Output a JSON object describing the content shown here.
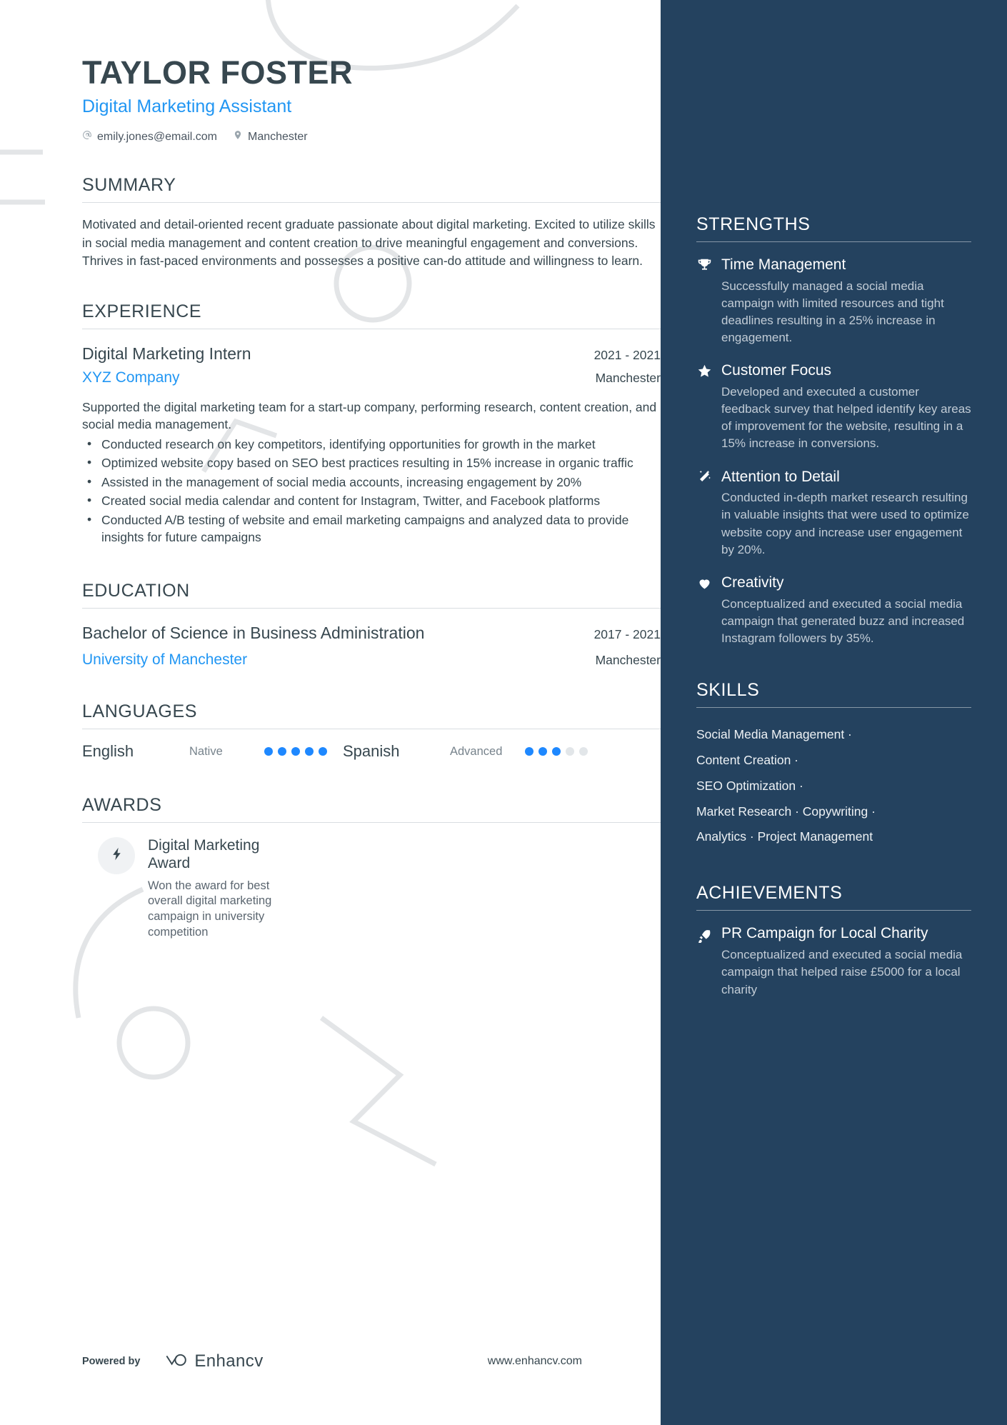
{
  "header": {
    "name": "TAYLOR FOSTER",
    "role": "Digital Marketing Assistant",
    "email": "emily.jones@email.com",
    "location": "Manchester"
  },
  "summary": {
    "title": "SUMMARY",
    "text": "Motivated and detail-oriented recent graduate passionate about digital marketing. Excited to utilize skills in social media management and content creation to drive meaningful engagement and conversions. Thrives in fast-paced environments and possesses a positive can-do attitude and willingness to learn."
  },
  "experience": {
    "title": "EXPERIENCE",
    "entries": [
      {
        "role": "Digital Marketing Intern",
        "date": "2021 - 2021",
        "company": "XYZ Company",
        "location": "Manchester",
        "description": "Supported the digital marketing team for a start-up company, performing research, content creation, and social media management.",
        "bullets": [
          "Conducted research on key competitors, identifying opportunities for growth in the market",
          "Optimized website copy based on SEO best practices resulting in 15% increase in organic traffic",
          "Assisted in the management of social media accounts, increasing engagement by 20%",
          "Created social media calendar and content for Instagram, Twitter, and Facebook platforms",
          "Conducted A/B testing of website and email marketing campaigns and analyzed data to provide insights for future campaigns"
        ]
      }
    ]
  },
  "education": {
    "title": "EDUCATION",
    "entries": [
      {
        "degree": "Bachelor of Science in Business Administration",
        "date": "2017 - 2021",
        "school": "University of Manchester",
        "location": "Manchester"
      }
    ]
  },
  "languages": {
    "title": "LANGUAGES",
    "items": [
      {
        "name": "English",
        "level": "Native",
        "rating": 5,
        "max": 5
      },
      {
        "name": "Spanish",
        "level": "Advanced",
        "rating": 3,
        "max": 5
      }
    ]
  },
  "awards": {
    "title": "AWARDS",
    "items": [
      {
        "icon": "lightning-bolt-icon",
        "title": "Digital Marketing Award",
        "description": "Won the award for best overall digital marketing campaign in university competition"
      }
    ]
  },
  "strengths": {
    "title": "STRENGTHS",
    "items": [
      {
        "icon": "trophy-icon",
        "title": "Time Management",
        "description": "Successfully managed a social media campaign with limited resources and tight deadlines resulting in a 25% increase in engagement."
      },
      {
        "icon": "star-icon",
        "title": "Customer Focus",
        "description": "Developed and executed a customer feedback survey that helped identify key areas of improvement for the website, resulting in a 15% increase in conversions."
      },
      {
        "icon": "magic-wand-icon",
        "title": "Attention to Detail",
        "description": "Conducted in-depth market research resulting in valuable insights that were used to optimize website copy and increase user engagement by 20%."
      },
      {
        "icon": "heart-icon",
        "title": "Creativity",
        "description": "Conceptualized and executed a social media campaign that generated buzz and increased Instagram followers by 35%."
      }
    ]
  },
  "skills": {
    "title": "SKILLS",
    "lines": [
      "Social Media Management ·",
      "Content Creation ·",
      "SEO Optimization ·",
      "Market Research · Copywriting ·",
      "Analytics · Project Management"
    ]
  },
  "achievements": {
    "title": "ACHIEVEMENTS",
    "items": [
      {
        "icon": "rocket-icon",
        "title": "PR Campaign for Local Charity",
        "description": "Conceptualized and executed a social media campaign that helped raise £5000 for a local charity"
      }
    ]
  },
  "footer": {
    "powered_by": "Powered by",
    "brand": "Enhancv",
    "website": "www.enhancv.com"
  },
  "colors": {
    "sidebar_bg": "#24425f",
    "accent_blue": "#2196f3",
    "heading": "#37474f",
    "dot_on": "#1e88ff",
    "dot_off": "#e2e6e9"
  }
}
